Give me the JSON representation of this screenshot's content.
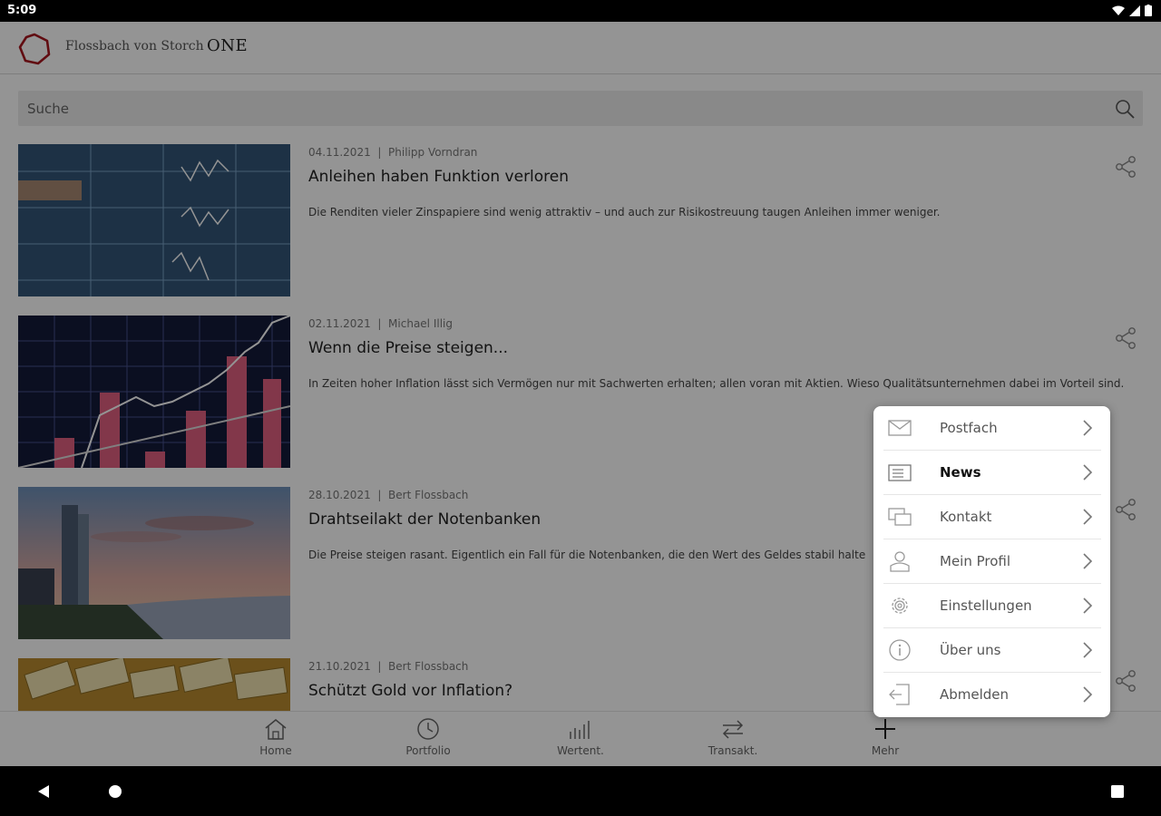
{
  "status": {
    "time": "5:09"
  },
  "header": {
    "brand": "Flossbach von Storch",
    "product": "ONE"
  },
  "search": {
    "placeholder": "Suche"
  },
  "articles": [
    {
      "date": "04.11.2021",
      "author": "Philipp Vorndran",
      "title": "Anleihen haben Funktion verloren",
      "teaser": "Die Renditen vieler Zinspapiere sind wenig attraktiv – und auch zur Risikostreuung taugen Anleihen immer weniger."
    },
    {
      "date": "02.11.2021",
      "author": "Michael Illig",
      "title": "Wenn die Preise steigen...",
      "teaser": "In Zeiten hoher Inflation lässt sich Vermögen nur mit Sachwerten erhalten; allen voran mit Aktien. Wieso Qualitätsunternehmen dabei im Vorteil sind."
    },
    {
      "date": "28.10.2021",
      "author": "Bert Flossbach",
      "title": "Drahtseilakt der Notenbanken",
      "teaser": "Die Preise steigen rasant. Eigentlich ein Fall für die Notenbanken, die den Wert des Geldes stabil halte                                  enzt."
    },
    {
      "date": "21.10.2021",
      "author": "Bert Flossbach",
      "title": "Schützt Gold vor Inflation?",
      "teaser": ""
    }
  ],
  "meta_separator": "|",
  "bottom_nav": [
    {
      "label": "Home",
      "icon": "home-icon"
    },
    {
      "label": "Portfolio",
      "icon": "clock-icon"
    },
    {
      "label": "Wertent.",
      "icon": "bar-chart-icon"
    },
    {
      "label": "Transakt.",
      "icon": "transfer-icon"
    },
    {
      "label": "Mehr",
      "icon": "plus-icon"
    }
  ],
  "menu": {
    "items": [
      {
        "label": "Postfach",
        "icon": "mail-icon"
      },
      {
        "label": "News",
        "icon": "newspaper-icon",
        "active": true
      },
      {
        "label": "Kontakt",
        "icon": "chat-icon"
      },
      {
        "label": "Mein Profil",
        "icon": "profile-icon"
      },
      {
        "label": "Einstellungen",
        "icon": "gear-icon"
      },
      {
        "label": "Über uns",
        "icon": "info-icon"
      },
      {
        "label": "Abmelden",
        "icon": "logout-icon"
      }
    ]
  },
  "colors": {
    "brand_red": "#a8151e",
    "overlay": "rgba(0,0,0,0.42)"
  }
}
